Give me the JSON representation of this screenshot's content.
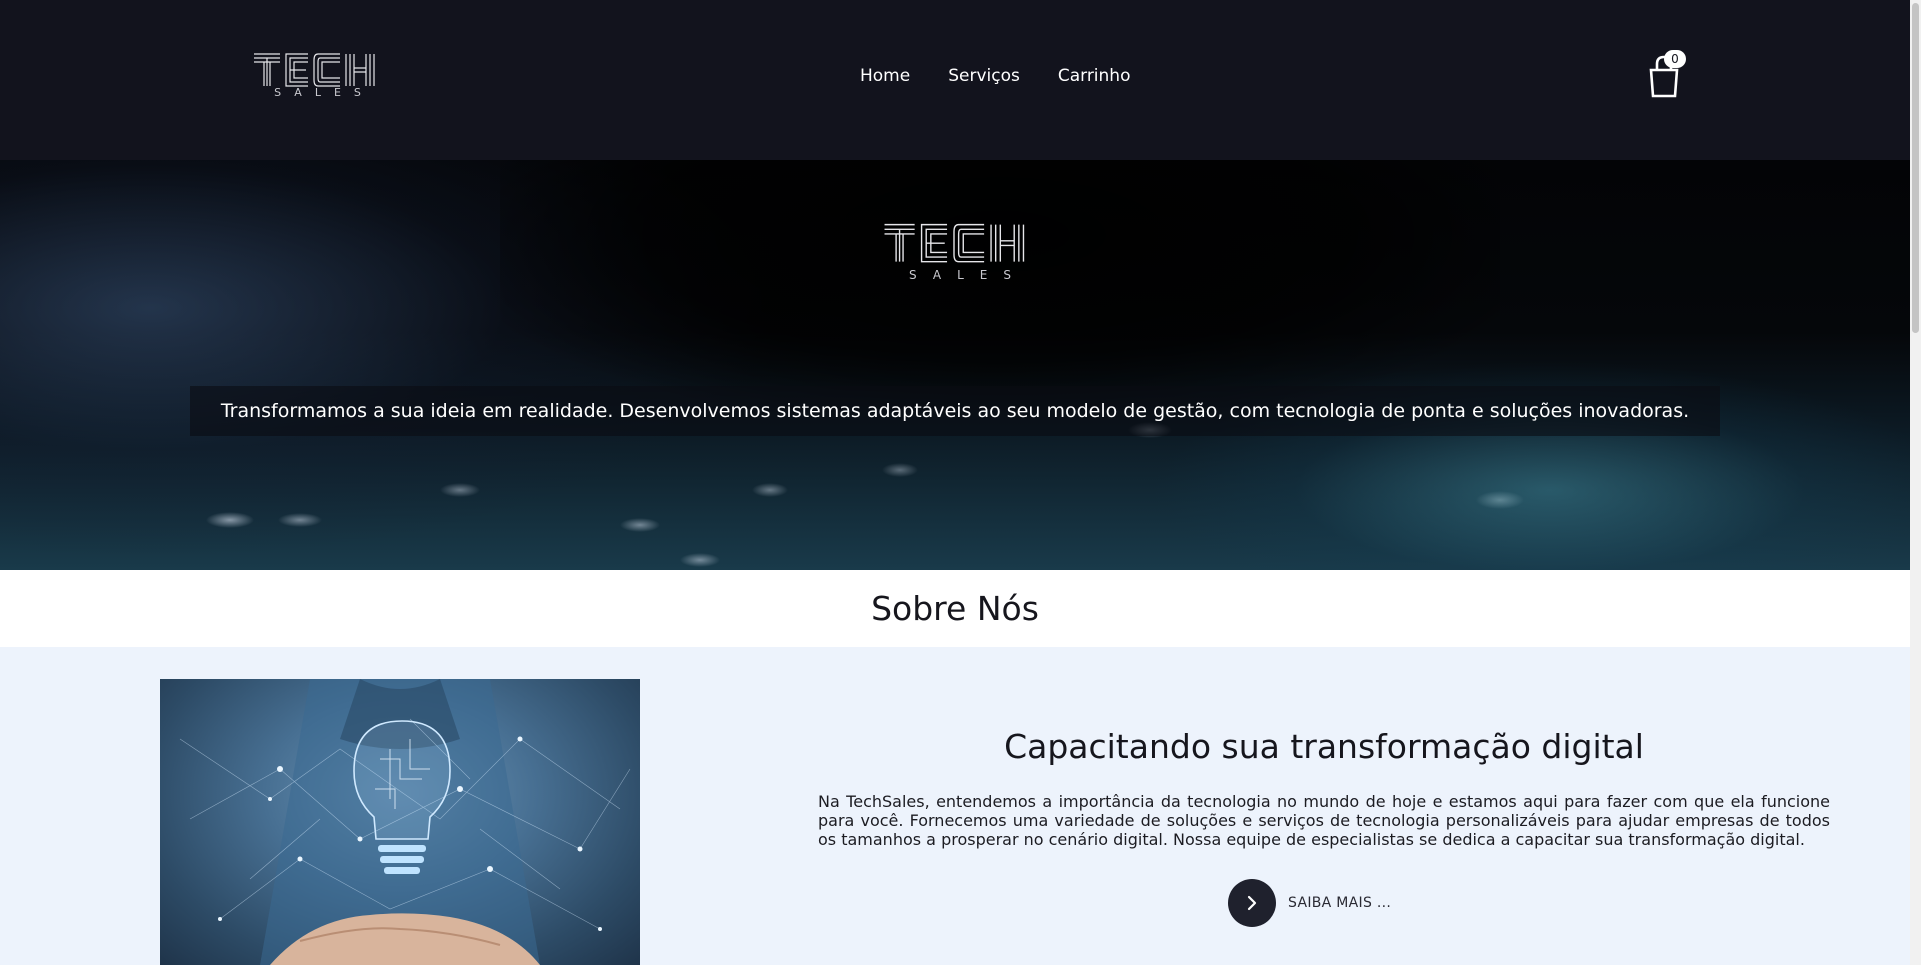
{
  "brand": {
    "logo_word": "TECH",
    "logo_sub": "SALES"
  },
  "nav": {
    "items": [
      {
        "label": "Home"
      },
      {
        "label": "Serviços"
      },
      {
        "label": "Carrinho"
      }
    ],
    "cart_count": "0"
  },
  "hero": {
    "logo_word": "TECH",
    "logo_sub": "SALES",
    "caption": "Transformamos a sua ideia em realidade. Desenvolvemos sistemas adaptáveis ao seu modelo de gestão, com tecnologia de ponta e soluções inovadoras."
  },
  "about": {
    "title": "Sobre Nós",
    "heading": "Capacitando sua transformação digital",
    "text": "Na TechSales, entendemos a importância da tecnologia no mundo de hoje e estamos aqui para fazer com que ela funcione para você. Fornecemos uma variedade de soluções e serviços de tecnologia personalizáveis para ajudar empresas de todos os tamanhos a prosperar no cenário digital. Nossa equipe de especialistas se dedica a capacitar sua transformação digital.",
    "button_label": "SAIBA MAIS ..."
  },
  "colors": {
    "navbar_bg": "#12131d",
    "section_bg": "#edf3fc",
    "button_bg": "#1f212d"
  },
  "icons": {
    "cart": "shopping-bag-icon",
    "more": "chevron-right-icon",
    "image": "lightbulb-hand-image"
  }
}
